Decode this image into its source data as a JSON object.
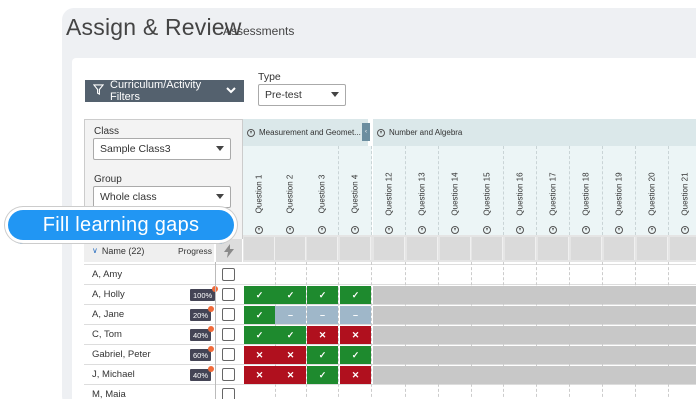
{
  "header": {
    "title": "Assign & Review",
    "subtitle": "Assessments"
  },
  "filters": {
    "button_label": "Curriculum/Activity Filters",
    "type_label": "Type",
    "type_value": "Pre-test"
  },
  "panel": {
    "class_label": "Class",
    "class_value": "Sample Class3",
    "group_label": "Group",
    "group_value": "Whole class"
  },
  "groups": [
    {
      "label": "Measurement and Geomet..."
    },
    {
      "label": "Number and Algebra"
    }
  ],
  "questions": [
    "Question 1",
    "Question 2",
    "Question 3",
    "Question 4",
    "Question 12",
    "Question 13",
    "Question 14",
    "Question 15",
    "Question 16",
    "Question 17",
    "Question 18",
    "Question 19",
    "Question 20",
    "Question 21"
  ],
  "table": {
    "name_header": "Name (22)",
    "progress_header": "Progress"
  },
  "students": [
    {
      "name": "A, Amy",
      "progress": "",
      "results": []
    },
    {
      "name": "A, Holly",
      "progress": "100%",
      "results": [
        "g",
        "g",
        "g",
        "g"
      ]
    },
    {
      "name": "A, Jane",
      "progress": "20%",
      "results": [
        "g",
        "b",
        "b",
        "b"
      ]
    },
    {
      "name": "C, Tom",
      "progress": "40%",
      "results": [
        "g",
        "g",
        "r",
        "r"
      ]
    },
    {
      "name": "Gabriel, Peter",
      "progress": "60%",
      "results": [
        "r",
        "r",
        "g",
        "g"
      ]
    },
    {
      "name": "J, Michael",
      "progress": "40%",
      "results": [
        "r",
        "r",
        "g",
        "r"
      ]
    },
    {
      "name": "M, Maia",
      "progress": "",
      "results": []
    }
  ],
  "marks": {
    "correct": "✓",
    "incorrect": "✕",
    "pending": "–"
  },
  "callout": {
    "label": "Fill learning gaps"
  },
  "colors": {
    "correct": "#1e8a2e",
    "incorrect": "#b0101e",
    "pending": "#9fb7c9",
    "accent": "#2196f3",
    "header_bar": "#54616e"
  }
}
